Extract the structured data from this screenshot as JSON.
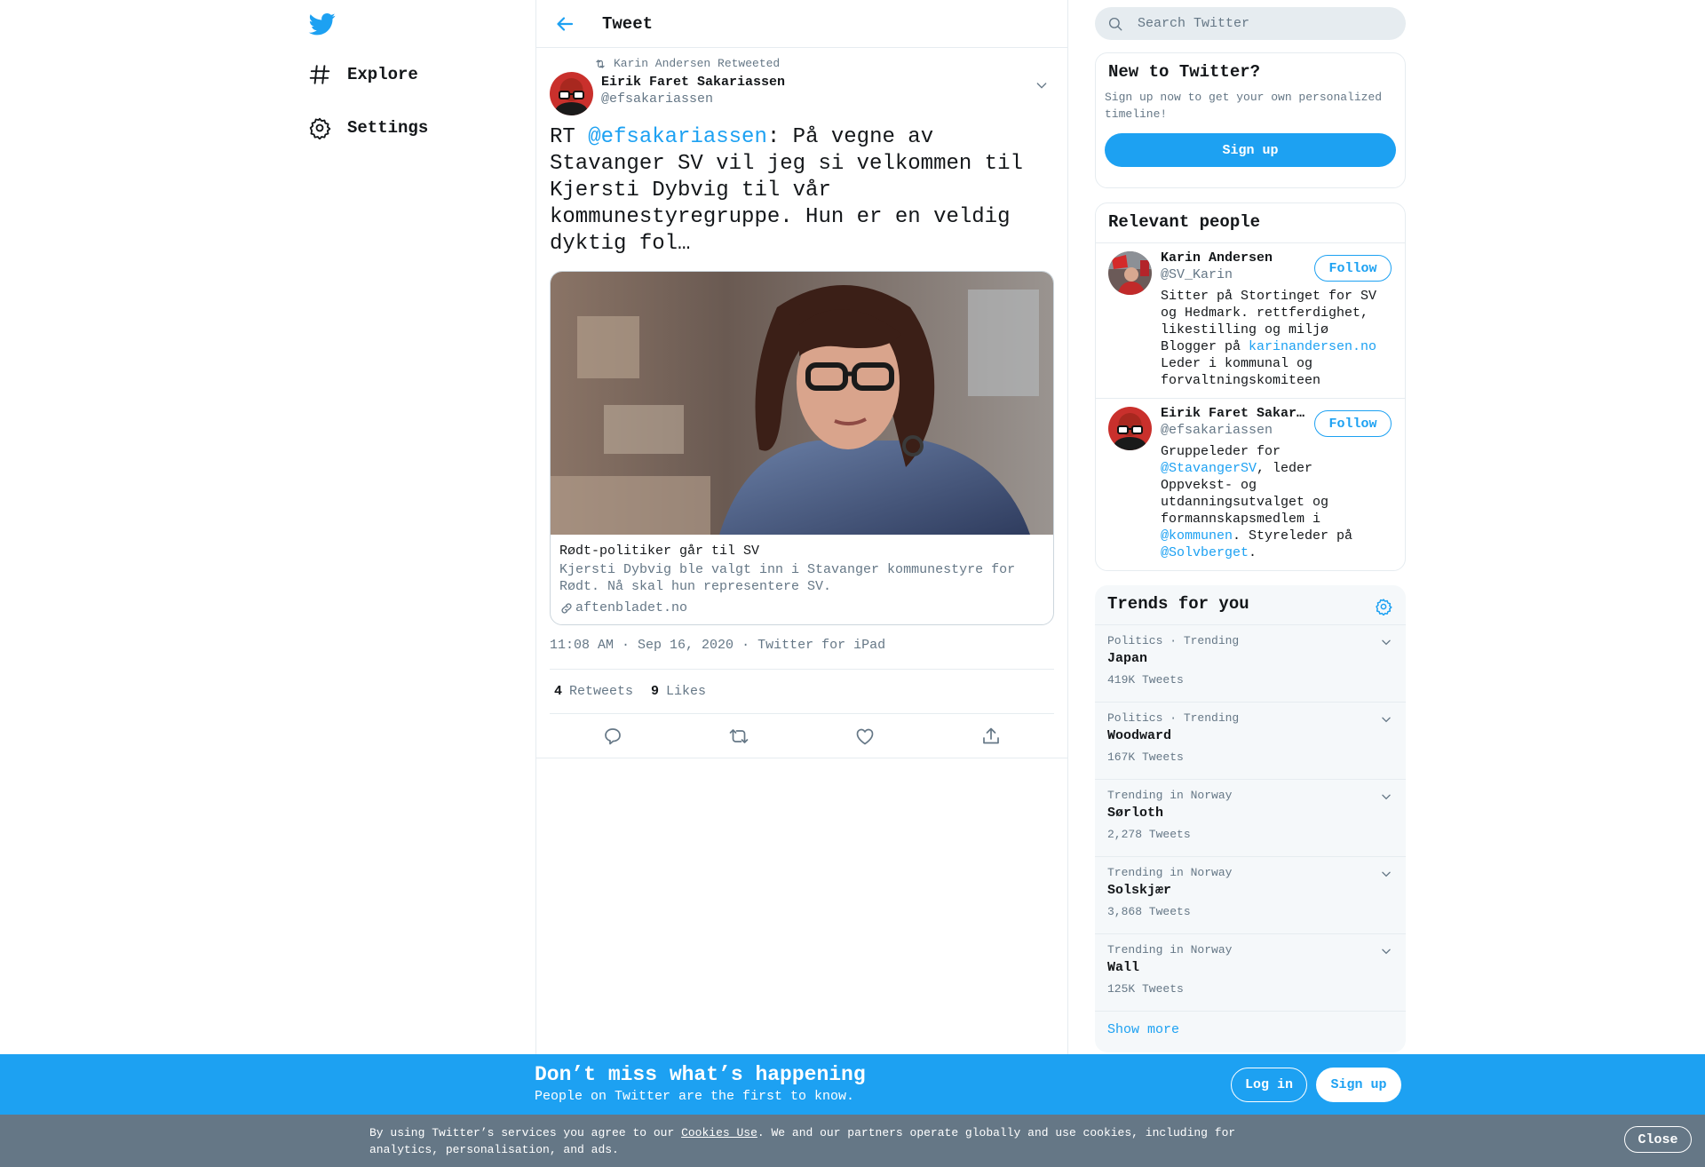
{
  "colors": {
    "accent": "#1da1f2",
    "text": "#14171a",
    "muted": "#657786",
    "border": "#e6ecf0",
    "cookie_bg": "#657786"
  },
  "nav": {
    "logo_icon": "twitter-bird-icon",
    "items": [
      {
        "label": "Explore",
        "icon": "hashtag-icon"
      },
      {
        "label": "Settings",
        "icon": "gear-icon"
      }
    ]
  },
  "header": {
    "title": "Tweet",
    "back_icon": "back-arrow-icon"
  },
  "tweet": {
    "retweeted_by": "Karin Andersen Retweeted",
    "author_name": "Eirik Faret Sakariassen",
    "author_handle": "@efsakariassen",
    "text_prefix": "RT ",
    "text_mention": "@efsakariassen",
    "text_rest": ": På vegne av Stavanger SV vil jeg si velkommen til Kjersti Dybvig til vår kommunestyregruppe. Hun er en veldig dyktig fol…",
    "card": {
      "title": "Rødt-politiker går til SV",
      "description": "Kjersti Dybvig ble valgt inn i Stavanger kommunestyre for Rødt. Nå skal hun representere SV.",
      "domain": "aftenbladet.no"
    },
    "time": "11:08 AM · Sep 16, 2020",
    "source": "Twitter for iPad",
    "retweets_count": "4",
    "retweets_label": "Retweets",
    "likes_count": "9",
    "likes_label": "Likes"
  },
  "search": {
    "placeholder": "Search Twitter"
  },
  "new_to_twitter": {
    "title": "New to Twitter?",
    "subtitle": "Sign up now to get your own personalized timeline!",
    "signup_label": "Sign up"
  },
  "relevant_people": {
    "title": "Relevant people",
    "follow_label": "Follow",
    "people": [
      {
        "name": "Karin Andersen",
        "handle": "@SV_Karin",
        "bio_a": "Sitter på Stortinget for SV og Hedmark. rettferdighet, likestilling og miljø Blogger på ",
        "bio_link1": "karinandersen.no",
        "bio_b": " Leder i kommunal og forvaltningskomiteen"
      },
      {
        "name": "Eirik Faret Sakariassen",
        "handle": "@efsakariassen",
        "bio_a": "Gruppeleder for ",
        "bio_link1": "@StavangerSV",
        "bio_b": ", leder Oppvekst- og utdanningsutvalget og formannskapsmedlem i ",
        "bio_link2": "@kommunen",
        "bio_c": ". Styreleder på ",
        "bio_link3": "@Solvberget",
        "bio_d": "."
      }
    ]
  },
  "trends": {
    "title": "Trends for you",
    "items": [
      {
        "meta": "Politics · Trending",
        "name": "Japan",
        "count": "419K Tweets"
      },
      {
        "meta": "Politics · Trending",
        "name": "Woodward",
        "count": "167K Tweets"
      },
      {
        "meta": "Trending in Norway",
        "name": "Sørloth",
        "count": "2,278 Tweets"
      },
      {
        "meta": "Trending in Norway",
        "name": "Solskjær",
        "count": "3,868 Tweets"
      },
      {
        "meta": "Trending in Norway",
        "name": "Wall",
        "count": "125K Tweets"
      }
    ],
    "show_more": "Show more"
  },
  "bottom_bar": {
    "title": "Don’t miss what’s happening",
    "subtitle": "People on Twitter are the first to know.",
    "login_label": "Log in",
    "signup_label": "Sign up"
  },
  "cookie_bar": {
    "text_a": "By using Twitter’s services you agree to our ",
    "link": "Cookies Use",
    "text_b": ". We and our partners operate globally and use cookies, including for analytics, personalisation, and ads.",
    "close_label": "Close"
  }
}
